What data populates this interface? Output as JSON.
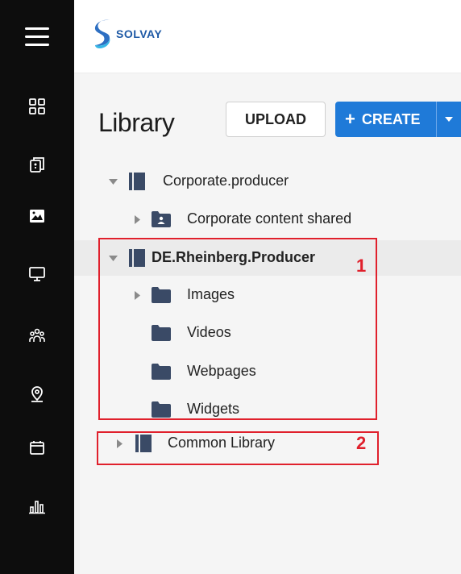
{
  "brand": {
    "name": "SOLVAY"
  },
  "rail": {
    "icons": [
      "menu-icon",
      "dashboard-icon",
      "copy-icon",
      "image-icon",
      "monitor-icon",
      "users-icon",
      "location-icon",
      "calendar-icon",
      "chart-icon"
    ]
  },
  "library": {
    "title": "Library",
    "upload_label": "UPLOAD",
    "create_label": "CREATE"
  },
  "tree": {
    "corporate_producer": "Corporate.producer",
    "corporate_shared": "Corporate content shared",
    "de_rheinberg": "DE.Rheinberg.Producer",
    "images": "Images",
    "videos": "Videos",
    "webpages": "Webpages",
    "widgets": "Widgets",
    "common_library": "Common Library"
  },
  "annotations": {
    "one": "1",
    "two": "2"
  },
  "colors": {
    "accent": "#1f7ad8",
    "rail": "#0d0d0d",
    "annotation": "#e0202c",
    "folder": "#3a4a66"
  }
}
